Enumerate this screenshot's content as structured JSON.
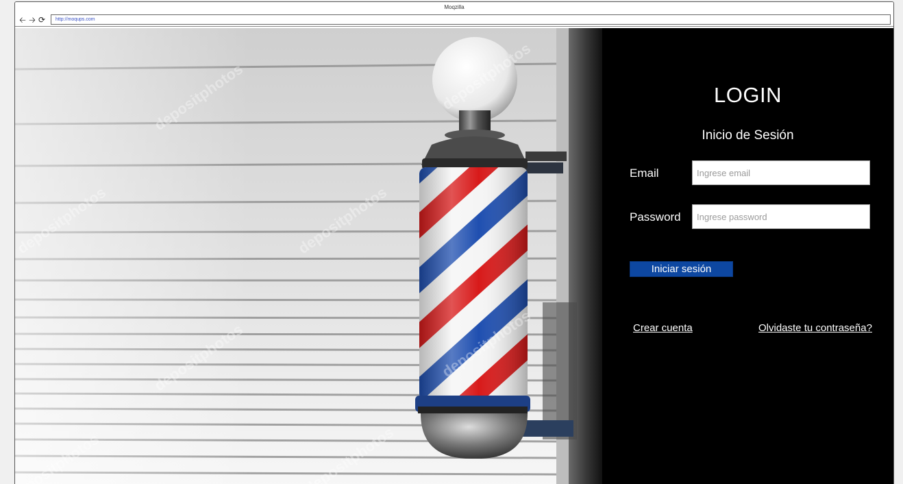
{
  "window": {
    "title": "Moqzilla"
  },
  "toolbar": {
    "back_icon": "arrow-left-icon",
    "forward_icon": "arrow-right-icon",
    "reload_icon": "reload-icon",
    "url": "http://moqups.com"
  },
  "photo": {
    "watermark": "depositphotos"
  },
  "login": {
    "title": "LOGIN",
    "subtitle": "Inicio de Sesión",
    "email_label": "Email",
    "email_placeholder": "Ingrese email",
    "email_value": "",
    "password_label": "Password",
    "password_placeholder": "Ingrese password",
    "password_value": "",
    "submit_label": "Iniciar sesión",
    "create_account_link": "Crear cuenta",
    "forgot_password_link": "Olvidaste tu contraseña?"
  },
  "colors": {
    "panel_background": "#000000",
    "button_background": "#0d47a1",
    "url_text": "#3a52c4",
    "pole_red": "#d81a1a",
    "pole_blue": "#1f4fb0"
  }
}
